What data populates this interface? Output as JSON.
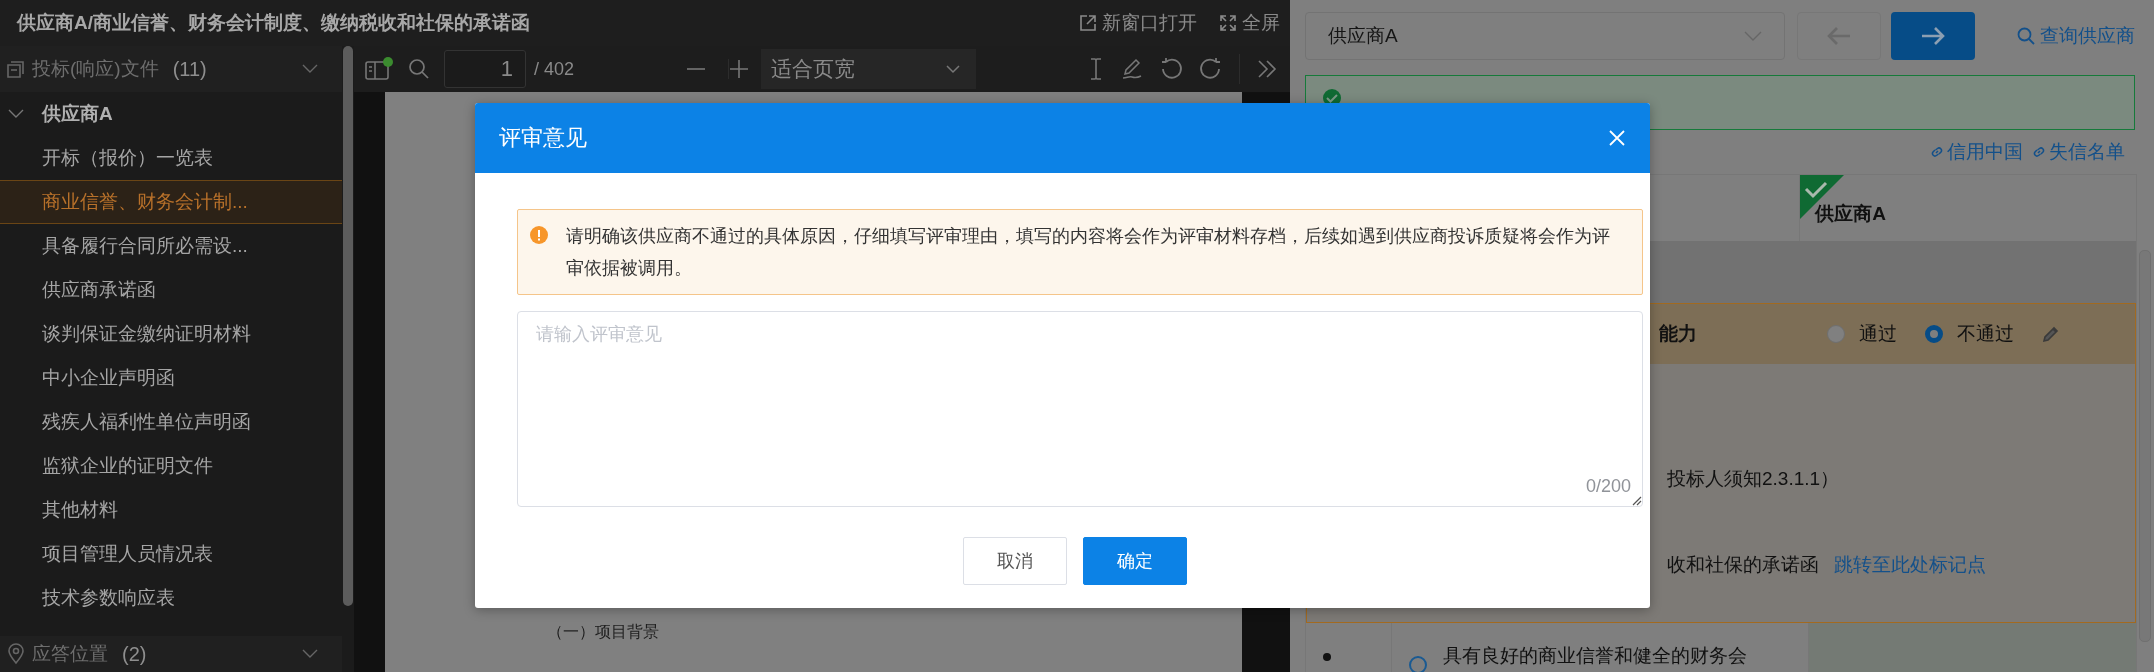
{
  "title_bar": {
    "title": "供应商A/商业信誉、财务会计制度、缴纳税收和社保的承诺函",
    "actions": [
      {
        "kind": "open-window",
        "label": "新窗口打开"
      },
      {
        "kind": "fullscreen",
        "label": "全屏"
      }
    ]
  },
  "file_panel": {
    "header": {
      "label": "投标(响应)文件",
      "count": "(11)"
    },
    "tree": [
      {
        "label": "供应商A",
        "expanded": true,
        "children": [
          {
            "label": "开标（报价）一览表",
            "selected": false
          },
          {
            "label": "商业信誉、财务会计制...",
            "selected": true
          },
          {
            "label": "具备履行合同所必需设...",
            "selected": false
          },
          {
            "label": "供应商承诺函",
            "selected": false
          },
          {
            "label": "谈判保证金缴纳证明材料",
            "selected": false
          },
          {
            "label": "中小企业声明函",
            "selected": false
          },
          {
            "label": "残疾人福利性单位声明函",
            "selected": false
          },
          {
            "label": "监狱企业的证明文件",
            "selected": false
          },
          {
            "label": "其他材料",
            "selected": false
          },
          {
            "label": "项目管理人员情况表",
            "selected": false
          },
          {
            "label": "技术参数响应表",
            "selected": false
          }
        ]
      }
    ],
    "footer": {
      "label": "应答位置",
      "count": "(2)"
    }
  },
  "pdf_toolbar": {
    "page": "1",
    "total": "/ 402",
    "zoom": "适合页宽"
  },
  "pdf_page": {
    "heading": "（一）项目背景"
  },
  "review_panel": {
    "supplier_select": "供应商A",
    "search_link": "查询供应商",
    "links": [
      "信用中国",
      "失信名单"
    ],
    "supplier_column": {
      "label": "供应商A",
      "checked": true
    },
    "criterion": {
      "title": "能力",
      "options": [
        {
          "label": "通过",
          "selected": false
        },
        {
          "label": "不通过",
          "selected": true
        }
      ],
      "details": [
        {
          "text": "投标人须知2.3.1.1）"
        },
        {
          "text": "收和社保的承诺函",
          "link": "跳转至此处标记点"
        }
      ]
    },
    "next_criterion": {
      "title": "具有良好的商业信誉和健全的财务会",
      "selected": false
    }
  },
  "dialog": {
    "title": "评审意见",
    "notice": "请明确该供应商不通过的具体原因，仔细填写评审理由，填写的内容将会作为评审材料存档，后续如遇到供应商投诉质疑将会作为评审依据被调用。",
    "placeholder": "请输入评审意见",
    "counter": "0/200",
    "buttons": [
      {
        "kind": "secondary",
        "label": "取消"
      },
      {
        "kind": "primary",
        "label": "确定"
      }
    ]
  }
}
